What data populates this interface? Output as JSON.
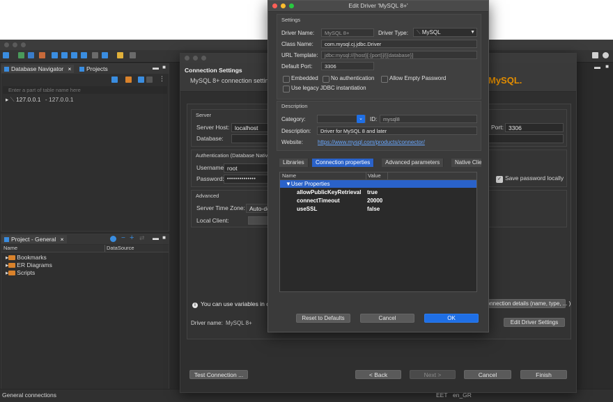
{
  "main": {
    "toolbar_right_icons": [
      "grid-icon",
      "palette-icon"
    ],
    "navigator": {
      "tabs": [
        {
          "label": "Database Navigator",
          "icon": "database-icon"
        },
        {
          "label": "Projects",
          "icon": "projects-icon"
        }
      ],
      "filter_placeholder": "Enter a part of table name here",
      "tree": [
        {
          "label": "127.0.0.1",
          "detail": "- 127.0.0.1"
        }
      ]
    },
    "project_panel": {
      "tab": "Project - General",
      "columns": [
        "Name",
        "DataSource"
      ],
      "items": [
        "Bookmarks",
        "ER Diagrams",
        "Scripts"
      ]
    },
    "status_bar": {
      "left": "General connections",
      "timezone": "EET",
      "locale": "en_GR"
    }
  },
  "connection_dialog": {
    "header_title": "Connection Settings",
    "header_subtitle": "MySQL 8+ connection settings",
    "logo_text": "MySQL.",
    "server": {
      "group_label": "Server",
      "host_label": "Server Host:",
      "host_value": "localhost",
      "port_label": "Port:",
      "port_value": "3306",
      "database_label": "Database:",
      "database_value": ""
    },
    "auth": {
      "group_label": "Authentication (Database Native)",
      "username_label": "Username:",
      "username_value": "root",
      "password_label": "Password:",
      "password_value": "••••••••••••••",
      "save_password_label": "Save password locally",
      "save_password_checked": true
    },
    "advanced": {
      "group_label": "Advanced",
      "timezone_label": "Server Time Zone:",
      "timezone_value": "Auto-detect",
      "local_client_label": "Local Client:"
    },
    "variables_note": "You can use variables in connection parameters.",
    "connection_details_button": "Connection details (name, type, ... )",
    "driver_name_label": "Driver name:",
    "driver_name_value": "MySQL 8+",
    "edit_driver_button": "Edit Driver Settings",
    "buttons": {
      "test": "Test Connection ...",
      "back": "< Back",
      "next": "Next >",
      "cancel": "Cancel",
      "finish": "Finish"
    }
  },
  "driver_dialog": {
    "title": "Edit Driver 'MySQL 8+'",
    "settings_label": "Settings",
    "driver_name_label": "Driver Name:",
    "driver_name_value": "MySQL 8+",
    "driver_type_label": "Driver Type:",
    "driver_type_value": "MySQL",
    "class_name_label": "Class Name:",
    "class_name_value": "com.mysql.cj.jdbc.Driver",
    "url_template_label": "URL Template:",
    "url_template_value": "jdbc:mysql://{host}[:{port}]/[{database}]",
    "default_port_label": "Default Port:",
    "default_port_value": "3306",
    "checkboxes": {
      "embedded": "Embedded",
      "no_auth": "No authentication",
      "allow_empty_password": "Allow Empty Password",
      "legacy_jdbc": "Use legacy JDBC instantiation"
    },
    "description_label": "Description",
    "category_label": "Category:",
    "category_value": "",
    "id_label": "ID:",
    "id_value": "mysql8",
    "description_field_label": "Description:",
    "description_value": "Driver for MySQL 8 and later",
    "website_label": "Website:",
    "website_value": "https://www.mysql.com/products/connector/",
    "tabs": [
      "Libraries",
      "Connection properties",
      "Advanced parameters",
      "Native Client"
    ],
    "active_tab": 1,
    "props_columns": [
      "Name",
      "Value"
    ],
    "props_group": "User Properties",
    "props": [
      {
        "name": "allowPublicKeyRetrieval",
        "value": "true"
      },
      {
        "name": "connectTimeout",
        "value": "20000"
      },
      {
        "name": "useSSL",
        "value": "false"
      }
    ],
    "buttons": {
      "reset": "Reset to Defaults",
      "cancel": "Cancel",
      "ok": "OK"
    }
  },
  "colors": {
    "accent_blue": "#1f6fe5",
    "mac_close": "#ff5f57",
    "mac_minimize": "#febc2e",
    "mac_zoom": "#28c840",
    "mysql_logo": "#e48e00"
  }
}
